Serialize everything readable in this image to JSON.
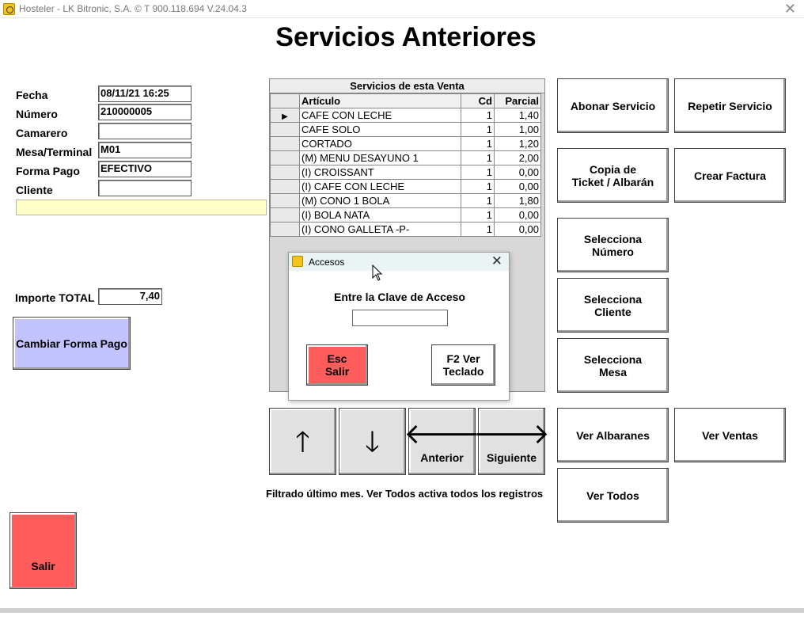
{
  "window": {
    "title": "Hosteler - LK Bitronic, S.A. ©  T 900.118.694 V.24.04.3",
    "close_icon": "close-icon"
  },
  "page_title": "Servicios Anteriores",
  "form": {
    "fecha_label": "Fecha",
    "fecha_value": "08/11/21 16:25",
    "numero_label": "Número",
    "numero_value": "210000005",
    "camarero_label": "Camarero",
    "camarero_value": "",
    "mesa_label": "Mesa/Terminal",
    "mesa_value": "M01",
    "forma_pago_label": "Forma Pago",
    "forma_pago_value": "EFECTIVO",
    "cliente_label": "Cliente",
    "cliente_value": "",
    "importe_label": "Importe TOTAL",
    "importe_value": "7,40",
    "yellow_bar_color": "#ffffc8"
  },
  "left_buttons": {
    "cambiar_forma_pago": "Cambiar Forma Pago",
    "salir": "Salir"
  },
  "grid": {
    "header": "Servicios de esta Venta",
    "columns": [
      "Artículo",
      "Cd",
      "Parcial"
    ],
    "rows": [
      {
        "articulo": "CAFE CON LECHE",
        "cd": "1",
        "parcial": "1,40"
      },
      {
        "articulo": "CAFE SOLO",
        "cd": "1",
        "parcial": "1,00"
      },
      {
        "articulo": "CORTADO",
        "cd": "1",
        "parcial": "1,20"
      },
      {
        "articulo": "(M) MENU DESAYUNO 1",
        "cd": "1",
        "parcial": "2,00"
      },
      {
        "articulo": "(I) CROISSANT",
        "cd": "1",
        "parcial": "0,00"
      },
      {
        "articulo": "(I) CAFE CON LECHE",
        "cd": "1",
        "parcial": "0,00"
      },
      {
        "articulo": "(M) CONO 1 BOLA",
        "cd": "1",
        "parcial": "1,80"
      },
      {
        "articulo": "(I) BOLA NATA",
        "cd": "1",
        "parcial": "0,00"
      },
      {
        "articulo": "(I) CONO GALLETA -P-",
        "cd": "1",
        "parcial": "0,00"
      }
    ]
  },
  "nav": {
    "up_icon": "arrow-up-icon",
    "down_icon": "arrow-down-icon",
    "anterior": "Anterior",
    "siguiente": "Siguiente"
  },
  "note": "Filtrado último mes. Ver Todos activa todos los registros",
  "right_buttons": {
    "abonar": "Abonar Servicio",
    "repetir": "Repetir Servicio",
    "copia": "Copia de\nTicket / Albarán",
    "crear_factura": "Crear Factura",
    "sel_numero": "Selecciona\nNúmero",
    "sel_cliente": "Selecciona\nCliente",
    "sel_mesa": "Selecciona\nMesa",
    "ver_albaranes": "Ver Albaranes",
    "ver_ventas": "Ver Ventas",
    "ver_todos": "Ver Todos"
  },
  "dialog": {
    "title": "Accesos",
    "prompt": "Entre la Clave de Acceso",
    "password_value": "",
    "esc_label": "Esc\nSalir",
    "f2_label": "F2 Ver\nTeclado"
  },
  "colors": {
    "purple_button": "#c3c3ff",
    "red_button": "#ff5c5c",
    "nav_button": "#e1e1e1"
  }
}
